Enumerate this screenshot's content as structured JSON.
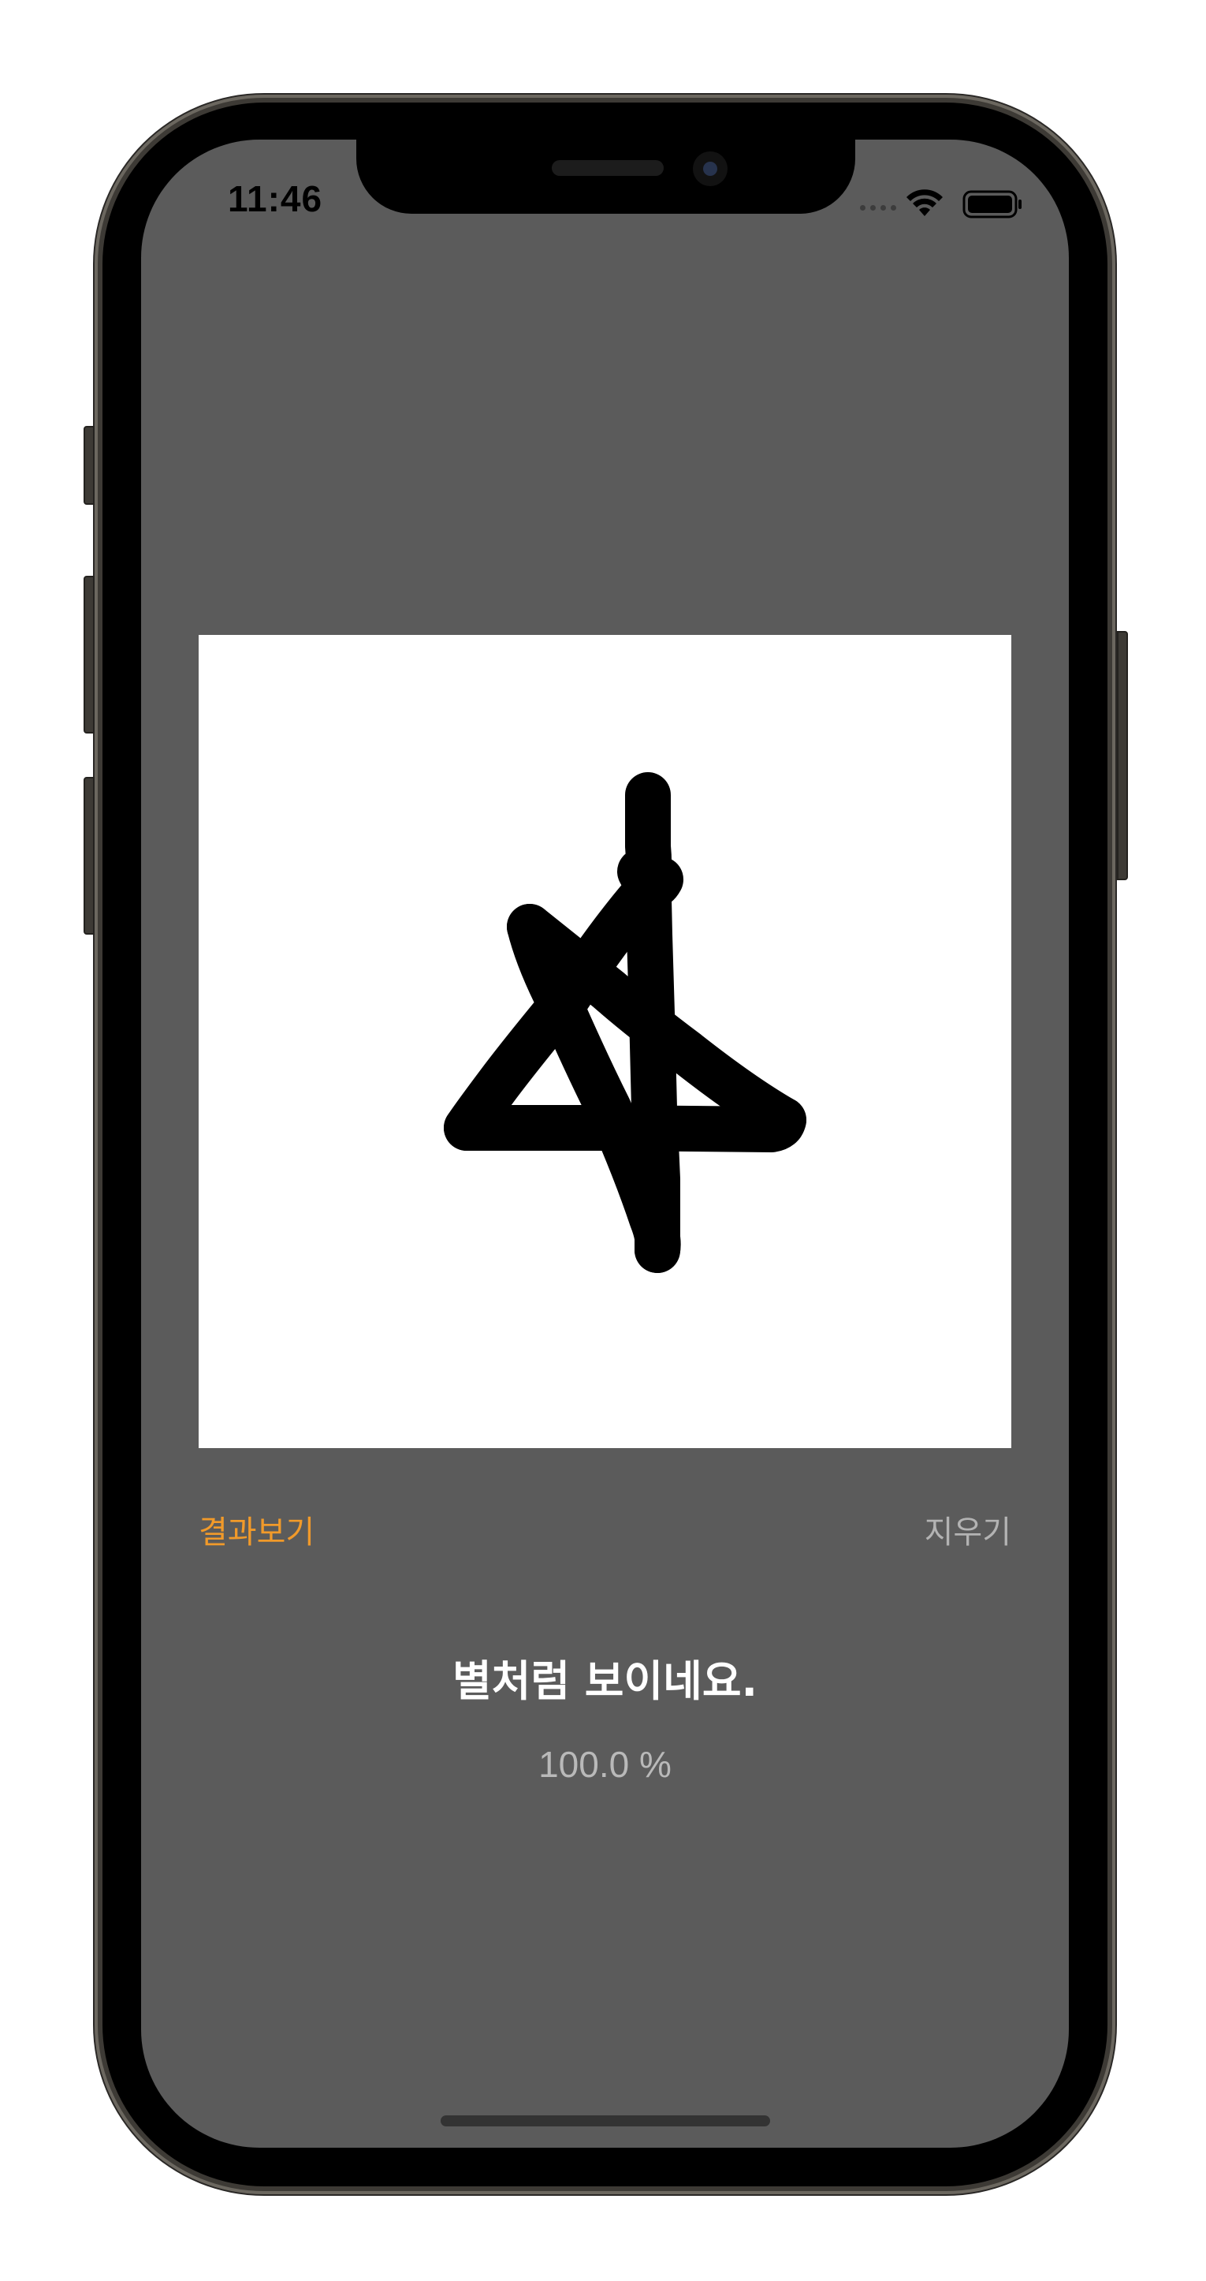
{
  "status_bar": {
    "time": "11:46",
    "icons": [
      "signal-dots-icon",
      "wifi-icon",
      "battery-icon"
    ]
  },
  "drawing_canvas": {
    "background": "#ffffff",
    "stroke_color": "#000000",
    "content": "hand-drawn star"
  },
  "controls": {
    "result_button_label": "결과보기",
    "result_button_color": "#f19a2a",
    "clear_button_label": "지우기",
    "clear_button_color": "#b3b3b3"
  },
  "result": {
    "label": "별처럼 보이네요.",
    "confidence": "100.0 %"
  },
  "theme": {
    "screen_background": "#5b5b5b"
  }
}
